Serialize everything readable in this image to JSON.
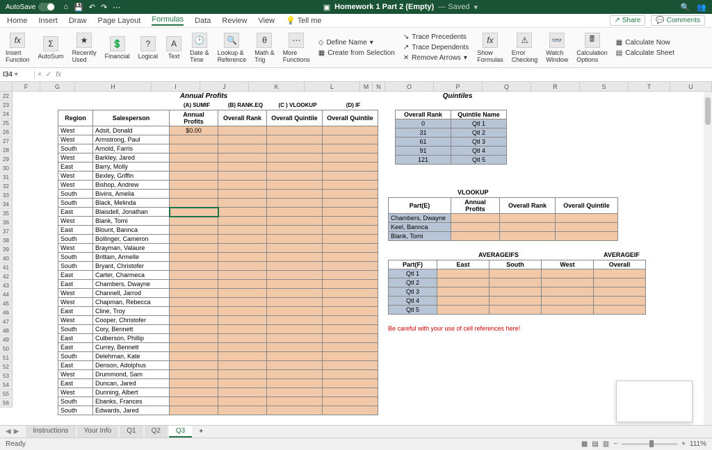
{
  "titlebar": {
    "autosave": "AutoSave",
    "filename": "Homework 1 Part 2 (Empty)",
    "saved": "— Saved"
  },
  "ribbon": {
    "tabs": [
      "Home",
      "Insert",
      "Draw",
      "Page Layout",
      "Formulas",
      "Data",
      "Review",
      "View",
      "Tell me"
    ],
    "active": "Formulas",
    "share": "Share",
    "comments": "Comments",
    "buttons": {
      "insert_function": "Insert\nFunction",
      "autosum": "AutoSum",
      "recently": "Recently\nUsed",
      "financial": "Financial",
      "logical": "Logical",
      "text": "Text",
      "datetime": "Date &\nTime",
      "lookup": "Lookup &\nReference",
      "math": "Math &\nTrig",
      "more": "More\nFunctions",
      "define_name": "Define Name",
      "create_sel": "Create from Selection",
      "trace_prec": "Trace Precedents",
      "trace_dep": "Trace Dependents",
      "remove_arr": "Remove Arrows",
      "show_formulas": "Show\nFormulas",
      "error_check": "Error\nChecking",
      "watch": "Watch\nWindow",
      "calc_opts": "Calculation\nOptions",
      "calc_now": "Calculate Now",
      "calc_sheet": "Calculate Sheet"
    }
  },
  "namebox": "I34",
  "fx_symbol": "fx",
  "columns": [
    "F",
    "G",
    "H",
    "I",
    "J",
    "K",
    "L",
    "M",
    "N",
    "O",
    "P",
    "Q",
    "R",
    "S",
    "T",
    "U"
  ],
  "row_start": 22,
  "row_end": 56,
  "headers": {
    "annual_profits": "Annual Profits",
    "a_sumif": "(A) SUMIF",
    "b_rankeq": "(B) RANK.EQ",
    "c_vlookup": "(C ) VLOOKUP",
    "d_if": "(D) IF",
    "region": "Region",
    "salesperson": "Salesperson",
    "annual_profits_col": "Annual\nProfits",
    "overall_rank": "Overall Rank",
    "overall_quintile": "Overall Quintile",
    "quintiles": "Quintiles",
    "quintile_name": "Quintile Name",
    "vlookup": "VLOOKUP",
    "parte": "Part(E)",
    "averageifs": "AVERAGEIFS",
    "averageif": "AVERAGEIF",
    "partf": "Part(F)",
    "east": "East",
    "south": "South",
    "west": "West",
    "overall": "Overall",
    "be_careful": "Be careful with your use of cell references here!"
  },
  "main_table": [
    {
      "region": "West",
      "person": "Adsit, Donald",
      "profit": "$0.00"
    },
    {
      "region": "West",
      "person": "Armstrong, Paul",
      "profit": ""
    },
    {
      "region": "South",
      "person": "Arnold, Farris",
      "profit": ""
    },
    {
      "region": "West",
      "person": "Barkley, Jared",
      "profit": ""
    },
    {
      "region": "East",
      "person": "Barry, Molly",
      "profit": ""
    },
    {
      "region": "West",
      "person": "Bexley, Griffin",
      "profit": ""
    },
    {
      "region": "West",
      "person": "Bishop, Andrew",
      "profit": ""
    },
    {
      "region": "South",
      "person": "Bivins, Amelia",
      "profit": ""
    },
    {
      "region": "South",
      "person": "Black, Melinda",
      "profit": ""
    },
    {
      "region": "East",
      "person": "Blaisdell, Jonathan",
      "profit": ""
    },
    {
      "region": "West",
      "person": "Blank, Tomi",
      "profit": ""
    },
    {
      "region": "East",
      "person": "Blount, Bannca",
      "profit": ""
    },
    {
      "region": "South",
      "person": "Bollinger, Cameron",
      "profit": ""
    },
    {
      "region": "West",
      "person": "Brayman, Valaure",
      "profit": ""
    },
    {
      "region": "South",
      "person": "Brittain, Armelle",
      "profit": ""
    },
    {
      "region": "South",
      "person": "Bryant, Christofer",
      "profit": ""
    },
    {
      "region": "East",
      "person": "Carter, Charmeca",
      "profit": ""
    },
    {
      "region": "East",
      "person": "Chambers, Dwayne",
      "profit": ""
    },
    {
      "region": "West",
      "person": "Channell, Jarrod",
      "profit": ""
    },
    {
      "region": "West",
      "person": "Chapman, Rebecca",
      "profit": ""
    },
    {
      "region": "East",
      "person": "Cline, Troy",
      "profit": ""
    },
    {
      "region": "West",
      "person": "Cooper, Christofer",
      "profit": ""
    },
    {
      "region": "South",
      "person": "Cory, Bennett",
      "profit": ""
    },
    {
      "region": "East",
      "person": "Culberson, Phillip",
      "profit": ""
    },
    {
      "region": "East",
      "person": "Currey, Bennett",
      "profit": ""
    },
    {
      "region": "South",
      "person": "Delehman, Kate",
      "profit": ""
    },
    {
      "region": "East",
      "person": "Denson, Adolphus",
      "profit": ""
    },
    {
      "region": "West",
      "person": "Drummond, Sam",
      "profit": ""
    },
    {
      "region": "East",
      "person": "Duncan, Jared",
      "profit": ""
    },
    {
      "region": "West",
      "person": "Dunning, Albert",
      "profit": ""
    },
    {
      "region": "South",
      "person": "Ebanks, Frances",
      "profit": ""
    },
    {
      "region": "South",
      "person": "Edwards, Jared",
      "profit": ""
    }
  ],
  "quintile_table": [
    {
      "rank": "0",
      "name": "Qtl 1"
    },
    {
      "rank": "31",
      "name": "Qtl 2"
    },
    {
      "rank": "61",
      "name": "Qtl 3"
    },
    {
      "rank": "91",
      "name": "Qtl 4"
    },
    {
      "rank": "121",
      "name": "Qtl 5"
    }
  ],
  "vlookup_rows": [
    "Chambers, Dwayne",
    "Keel, Bannca",
    "Blank, Tomi"
  ],
  "partf_rows": [
    "Qtl 1",
    "Qtl 2",
    "Qtl 3",
    "Qtl 4",
    "Qtl 5"
  ],
  "sheet_tabs": [
    "Instructions",
    "Your Info",
    "Q1",
    "Q2",
    "Q3"
  ],
  "active_sheet": "Q3",
  "status": {
    "ready": "Ready",
    "zoom": "111%"
  }
}
